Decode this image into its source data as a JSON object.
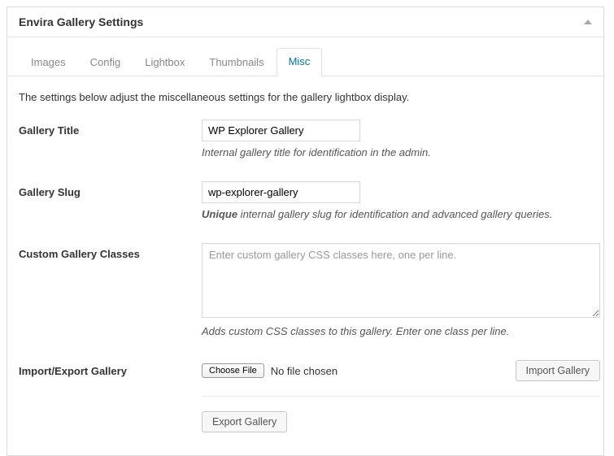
{
  "panel": {
    "title": "Envira Gallery Settings"
  },
  "tabs": [
    "Images",
    "Config",
    "Lightbox",
    "Thumbnails",
    "Misc"
  ],
  "active_tab_index": 4,
  "intro": "The settings below adjust the miscellaneous settings for the gallery lightbox display.",
  "fields": {
    "title": {
      "label": "Gallery Title",
      "value": "WP Explorer Gallery",
      "help": "Internal gallery title for identification in the admin."
    },
    "slug": {
      "label": "Gallery Slug",
      "value": "wp-explorer-gallery",
      "help_prefix": "Unique",
      "help_rest": " internal gallery slug for identification and advanced gallery queries."
    },
    "classes": {
      "label": "Custom Gallery Classes",
      "placeholder": "Enter custom gallery CSS classes here, one per line.",
      "help": "Adds custom CSS classes to this gallery. Enter one class per line."
    },
    "io": {
      "label": "Import/Export Gallery",
      "choose_file": "Choose File",
      "no_file": "No file chosen",
      "import_btn": "Import Gallery",
      "export_btn": "Export Gallery"
    }
  }
}
